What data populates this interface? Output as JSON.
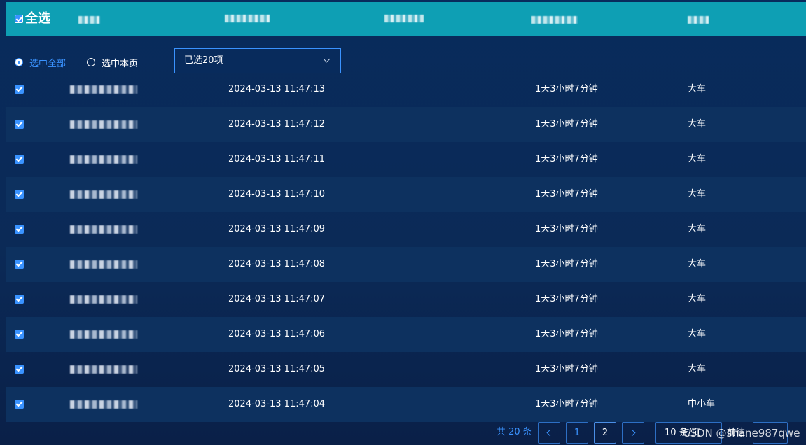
{
  "header": {
    "select_all_label": "全选"
  },
  "selection": {
    "options": [
      {
        "label": "选中全部",
        "checked": true
      },
      {
        "label": "选中本页",
        "checked": false
      }
    ],
    "dropdown_value": "已选20项"
  },
  "rows": [
    {
      "time": "2024-03-13 11:47:13",
      "duration": "1天3小时7分钟",
      "type": "大车"
    },
    {
      "time": "2024-03-13 11:47:12",
      "duration": "1天3小时7分钟",
      "type": "大车"
    },
    {
      "time": "2024-03-13 11:47:11",
      "duration": "1天3小时7分钟",
      "type": "大车"
    },
    {
      "time": "2024-03-13 11:47:10",
      "duration": "1天3小时7分钟",
      "type": "大车"
    },
    {
      "time": "2024-03-13 11:47:09",
      "duration": "1天3小时7分钟",
      "type": "大车"
    },
    {
      "time": "2024-03-13 11:47:08",
      "duration": "1天3小时7分钟",
      "type": "大车"
    },
    {
      "time": "2024-03-13 11:47:07",
      "duration": "1天3小时7分钟",
      "type": "大车"
    },
    {
      "time": "2024-03-13 11:47:06",
      "duration": "1天3小时7分钟",
      "type": "大车"
    },
    {
      "time": "2024-03-13 11:47:05",
      "duration": "1天3小时7分钟",
      "type": "大车"
    },
    {
      "time": "2024-03-13 11:47:04",
      "duration": "1天3小时7分钟",
      "type": "中小车"
    }
  ],
  "pagination": {
    "total_label": "共 20 条",
    "pages": [
      "1",
      "2"
    ],
    "current_page": "2",
    "page_size_label": "10 条/页",
    "goto_label": "前往",
    "page_unit": "页"
  },
  "watermark": "CSDN @shane987qwe",
  "colors": {
    "header_bg": "#0e9fb4",
    "accent": "#3a93ff",
    "background": "#0a2550"
  }
}
